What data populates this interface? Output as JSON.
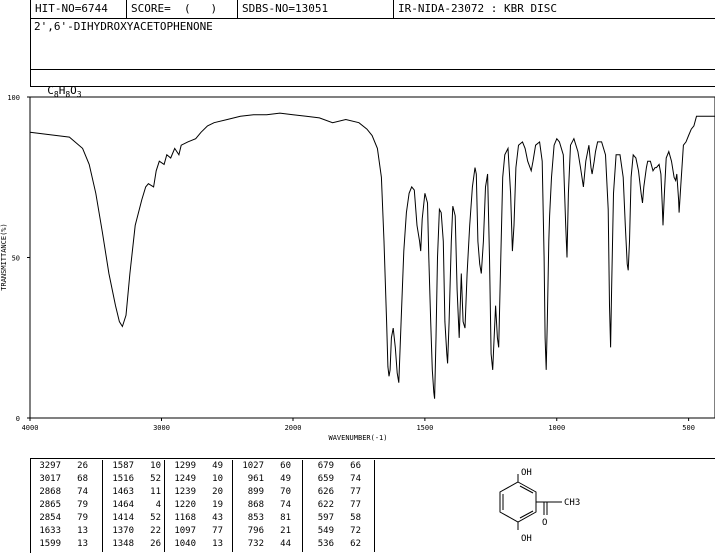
{
  "header": {
    "hit_no": "HIT-NO=6744",
    "score": "SCORE=  (   )",
    "sdbs_no": "SDBS-NO=13051",
    "ir_info": "IR-NIDA-23072 : KBR DISC"
  },
  "compound_name": "2',6'-DIHYDROXYACETOPHENONE",
  "formula": {
    "c": "C",
    "c_n": "8",
    "h": "H",
    "h_n": "8",
    "o": "O",
    "o_n": "3"
  },
  "chart_data": {
    "type": "line",
    "xlabel": "WAVENUMBER(-1)",
    "ylabel": "TRANSMITTANCE(%)",
    "xlim": [
      4000,
      400
    ],
    "ylim": [
      0,
      100
    ],
    "x_ticks": [
      4000,
      3000,
      2000,
      1500,
      1000,
      500
    ],
    "y_ticks": [
      0,
      50,
      100
    ],
    "x_tick_labels": [
      "4000",
      "3000",
      "2000",
      "1500",
      "1000",
      "500"
    ],
    "y_tick_labels": [
      "0",
      "50",
      "100"
    ],
    "series": [
      {
        "points": [
          [
            4000,
            89
          ],
          [
            3900,
            88.5
          ],
          [
            3800,
            88
          ],
          [
            3700,
            87.5
          ],
          [
            3600,
            84
          ],
          [
            3550,
            79
          ],
          [
            3500,
            70
          ],
          [
            3450,
            58
          ],
          [
            3400,
            45
          ],
          [
            3350,
            35
          ],
          [
            3320,
            30
          ],
          [
            3297,
            28.5
          ],
          [
            3270,
            32
          ],
          [
            3240,
            45
          ],
          [
            3200,
            60
          ],
          [
            3150,
            68
          ],
          [
            3120,
            72
          ],
          [
            3100,
            73
          ],
          [
            3060,
            72
          ],
          [
            3040,
            77
          ],
          [
            3017,
            80
          ],
          [
            2980,
            79
          ],
          [
            2960,
            82
          ],
          [
            2930,
            81
          ],
          [
            2900,
            84
          ],
          [
            2868,
            82
          ],
          [
            2850,
            85
          ],
          [
            2800,
            86
          ],
          [
            2740,
            87
          ],
          [
            2700,
            89
          ],
          [
            2650,
            91
          ],
          [
            2600,
            92
          ],
          [
            2500,
            93
          ],
          [
            2400,
            94
          ],
          [
            2300,
            94.5
          ],
          [
            2200,
            94.5
          ],
          [
            2100,
            95
          ],
          [
            2000,
            94.5
          ],
          [
            1950,
            94
          ],
          [
            1900,
            93.5
          ],
          [
            1850,
            92
          ],
          [
            1800,
            93
          ],
          [
            1750,
            92
          ],
          [
            1720,
            90
          ],
          [
            1700,
            88
          ],
          [
            1680,
            84
          ],
          [
            1665,
            75
          ],
          [
            1655,
            55
          ],
          [
            1645,
            30
          ],
          [
            1640,
            16
          ],
          [
            1636,
            13
          ],
          [
            1632,
            15
          ],
          [
            1627,
            25
          ],
          [
            1620,
            28
          ],
          [
            1612,
            22
          ],
          [
            1605,
            14
          ],
          [
            1599,
            11
          ],
          [
            1590,
            30
          ],
          [
            1580,
            52
          ],
          [
            1570,
            64
          ],
          [
            1560,
            70
          ],
          [
            1550,
            72
          ],
          [
            1540,
            71
          ],
          [
            1530,
            60
          ],
          [
            1520,
            55
          ],
          [
            1516,
            52
          ],
          [
            1510,
            62
          ],
          [
            1500,
            70
          ],
          [
            1490,
            67
          ],
          [
            1485,
            50
          ],
          [
            1478,
            30
          ],
          [
            1472,
            15
          ],
          [
            1466,
            8
          ],
          [
            1463,
            6
          ],
          [
            1458,
            25
          ],
          [
            1452,
            50
          ],
          [
            1445,
            65
          ],
          [
            1438,
            64
          ],
          [
            1430,
            55
          ],
          [
            1424,
            30
          ],
          [
            1417,
            20
          ],
          [
            1414,
            17
          ],
          [
            1408,
            30
          ],
          [
            1400,
            55
          ],
          [
            1394,
            66
          ],
          [
            1385,
            63
          ],
          [
            1378,
            40
          ],
          [
            1370,
            25
          ],
          [
            1362,
            45
          ],
          [
            1355,
            30
          ],
          [
            1348,
            28
          ],
          [
            1340,
            45
          ],
          [
            1330,
            60
          ],
          [
            1320,
            72
          ],
          [
            1310,
            78
          ],
          [
            1305,
            76
          ],
          [
            1299,
            55
          ],
          [
            1292,
            48
          ],
          [
            1286,
            45
          ],
          [
            1278,
            55
          ],
          [
            1270,
            72
          ],
          [
            1262,
            76
          ],
          [
            1255,
            50
          ],
          [
            1249,
            20
          ],
          [
            1243,
            15
          ],
          [
            1239,
            22
          ],
          [
            1232,
            35
          ],
          [
            1225,
            25
          ],
          [
            1220,
            22
          ],
          [
            1212,
            50
          ],
          [
            1205,
            75
          ],
          [
            1197,
            82
          ],
          [
            1185,
            84
          ],
          [
            1175,
            70
          ],
          [
            1168,
            52
          ],
          [
            1162,
            60
          ],
          [
            1155,
            78
          ],
          [
            1145,
            85
          ],
          [
            1130,
            86
          ],
          [
            1120,
            84
          ],
          [
            1110,
            80
          ],
          [
            1097,
            77
          ],
          [
            1090,
            80
          ],
          [
            1080,
            85
          ],
          [
            1065,
            86
          ],
          [
            1055,
            80
          ],
          [
            1048,
            50
          ],
          [
            1044,
            25
          ],
          [
            1040,
            15
          ],
          [
            1036,
            30
          ],
          [
            1030,
            55
          ],
          [
            1027,
            63
          ],
          [
            1020,
            75
          ],
          [
            1010,
            85
          ],
          [
            1000,
            87
          ],
          [
            990,
            86
          ],
          [
            975,
            82
          ],
          [
            966,
            60
          ],
          [
            961,
            50
          ],
          [
            956,
            70
          ],
          [
            948,
            85
          ],
          [
            935,
            87
          ],
          [
            920,
            83
          ],
          [
            910,
            78
          ],
          [
            899,
            72
          ],
          [
            890,
            80
          ],
          [
            878,
            85
          ],
          [
            870,
            78
          ],
          [
            866,
            76
          ],
          [
            858,
            80
          ],
          [
            853,
            83
          ],
          [
            845,
            86
          ],
          [
            830,
            86
          ],
          [
            815,
            82
          ],
          [
            805,
            65
          ],
          [
            800,
            35
          ],
          [
            796,
            22
          ],
          [
            792,
            40
          ],
          [
            785,
            70
          ],
          [
            775,
            82
          ],
          [
            760,
            82
          ],
          [
            748,
            75
          ],
          [
            740,
            60
          ],
          [
            733,
            48
          ],
          [
            729,
            46
          ],
          [
            724,
            55
          ],
          [
            718,
            75
          ],
          [
            710,
            82
          ],
          [
            700,
            81
          ],
          [
            690,
            77
          ],
          [
            680,
            70
          ],
          [
            675,
            67
          ],
          [
            670,
            72
          ],
          [
            660,
            78
          ],
          [
            655,
            80
          ],
          [
            645,
            80
          ],
          [
            635,
            77
          ],
          [
            627,
            78
          ],
          [
            622,
            78
          ],
          [
            612,
            79
          ],
          [
            605,
            76
          ],
          [
            600,
            66
          ],
          [
            597,
            60
          ],
          [
            592,
            70
          ],
          [
            585,
            81
          ],
          [
            575,
            83
          ],
          [
            565,
            80
          ],
          [
            555,
            75
          ],
          [
            549,
            74
          ],
          [
            545,
            76
          ],
          [
            538,
            68
          ],
          [
            536,
            64
          ],
          [
            530,
            72
          ],
          [
            520,
            85
          ],
          [
            510,
            86
          ],
          [
            500,
            88
          ],
          [
            490,
            90
          ],
          [
            480,
            91
          ],
          [
            470,
            94
          ],
          [
            460,
            94
          ],
          [
            450,
            94
          ],
          [
            440,
            94
          ],
          [
            430,
            94
          ],
          [
            420,
            94
          ],
          [
            400,
            94
          ]
        ]
      }
    ],
    "peak_table": [
      [
        [
          "3297",
          "26"
        ],
        [
          "3017",
          "68"
        ],
        [
          "2868",
          "74"
        ],
        [
          "2865",
          "79"
        ],
        [
          "2854",
          "79"
        ],
        [
          "1633",
          "13"
        ],
        [
          "1599",
          "13"
        ]
      ],
      [
        [
          "1587",
          "10"
        ],
        [
          "1516",
          "52"
        ],
        [
          "1463",
          "11"
        ],
        [
          "1464",
          "4"
        ],
        [
          "1414",
          "52"
        ],
        [
          "1370",
          "22"
        ],
        [
          "1348",
          "26"
        ]
      ],
      [
        [
          "1299",
          "49"
        ],
        [
          "1249",
          "10"
        ],
        [
          "1239",
          "20"
        ],
        [
          "1220",
          "19"
        ],
        [
          "1168",
          "43"
        ],
        [
          "1097",
          "77"
        ],
        [
          "1040",
          "13"
        ]
      ],
      [
        [
          "1027",
          "60"
        ],
        [
          "961",
          "49"
        ],
        [
          "899",
          "70"
        ],
        [
          "868",
          "74"
        ],
        [
          "853",
          "81"
        ],
        [
          "796",
          "21"
        ],
        [
          "732",
          "44"
        ]
      ],
      [
        [
          "679",
          "66"
        ],
        [
          "659",
          "74"
        ],
        [
          "626",
          "77"
        ],
        [
          "622",
          "77"
        ],
        [
          "597",
          "58"
        ],
        [
          "549",
          "72"
        ],
        [
          "536",
          "62"
        ]
      ]
    ]
  },
  "structure": {
    "oh_top": "OH",
    "oh_bottom": "OH",
    "o_label": "O",
    "ch3_label": "CH3"
  }
}
